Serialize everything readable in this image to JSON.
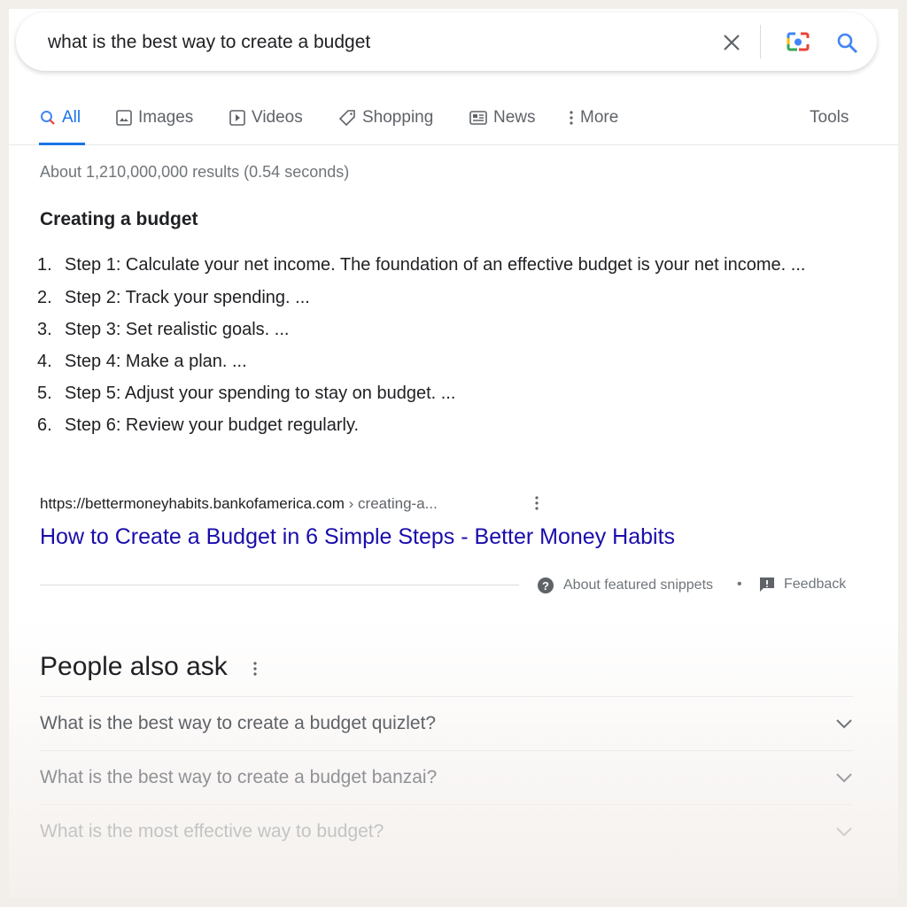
{
  "search": {
    "query": "what is the best way to create a budget",
    "icons": [
      "close-icon",
      "camera-lens-icon",
      "search-icon"
    ]
  },
  "tabs": [
    {
      "label": "All",
      "icon": "search-icon"
    },
    {
      "label": "Images",
      "icon": "image-icon"
    },
    {
      "label": "Videos",
      "icon": "play-icon"
    },
    {
      "label": "Shopping",
      "icon": "tag-icon"
    },
    {
      "label": "News",
      "icon": "news-icon"
    },
    {
      "label": "More",
      "icon": "more-vert-icon"
    }
  ],
  "tools_label": "Tools",
  "stats": "About 1,210,000,000 results (0.54 seconds)",
  "snippet": {
    "heading": "Creating a budget",
    "steps": [
      {
        "n": "1.",
        "text": "Step 1: Calculate your net income. The foundation of an effective budget is your net income. ..."
      },
      {
        "n": "2.",
        "text": "Step 2: Track your spending. ..."
      },
      {
        "n": "3.",
        "text": "Step 3: Set realistic goals. ..."
      },
      {
        "n": "4.",
        "text": "Step 4: Make a plan. ..."
      },
      {
        "n": "5.",
        "text": "Step 5: Adjust your spending to stay on budget. ..."
      },
      {
        "n": "6.",
        "text": "Step 6: Review your budget regularly."
      }
    ],
    "url": "https://bettermoneyhabits.bankofamerica.com",
    "crumb": " › creating-a...",
    "title": "How to Create a Budget in 6 Simple Steps - Better Money Habits",
    "about": "About featured snippets",
    "sep": "•",
    "feedback": "Feedback"
  },
  "paa": {
    "heading": "People also ask",
    "questions": [
      "What is the best way to create a budget quizlet?",
      "What is the best way to create a budget banzai?",
      "What is the most effective way to budget?"
    ]
  },
  "colors": {
    "accent": "#1a73e8",
    "link": "#1a0dab",
    "bg": "#f2eeea"
  }
}
